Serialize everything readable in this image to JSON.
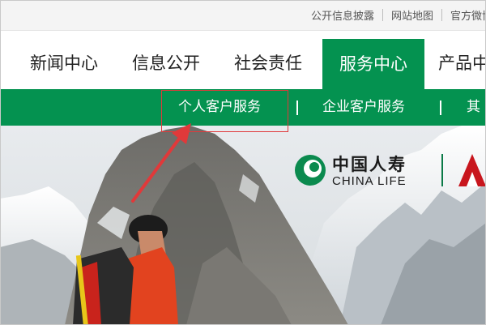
{
  "topbar": {
    "links": [
      "公开信息披露",
      "网站地图",
      "官方微博"
    ]
  },
  "mainnav": {
    "items": [
      "新闻中心",
      "信息公开",
      "社会责任",
      "服务中心",
      "产品中"
    ],
    "active": "服务中心"
  },
  "subnav": {
    "items": [
      "个人客户服务",
      "企业客户服务",
      "其"
    ],
    "separator": "|"
  },
  "hero": {
    "logo_cn": "中国人寿",
    "logo_en": "CHINA LIFE"
  },
  "colors": {
    "brand_green": "#049250",
    "annotation_red": "#e0393a"
  }
}
